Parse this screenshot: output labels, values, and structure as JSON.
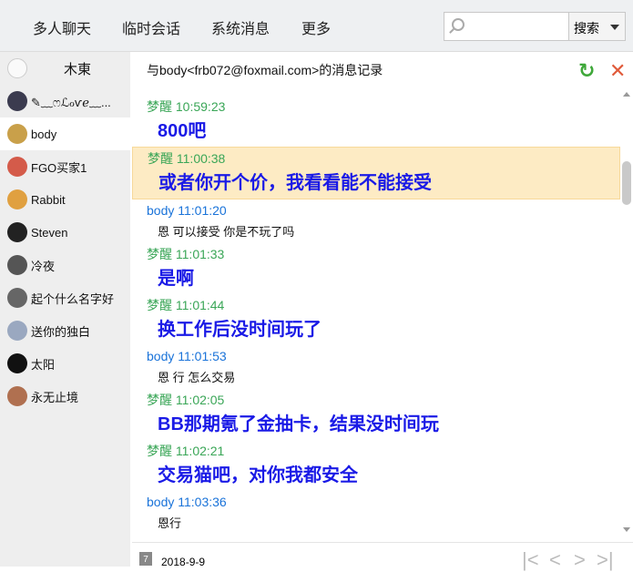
{
  "nav": {
    "items": [
      "多人聊天",
      "临时会话",
      "系统消息",
      "更多"
    ]
  },
  "search": {
    "placeholder": "",
    "button": "搜索"
  },
  "sidebar": {
    "items": [
      {
        "name": "木東",
        "color": "#fafafa"
      },
      {
        "name": "✎﹏ෆℒℴѵℯ﹏...",
        "color": "#3b3b4f"
      },
      {
        "name": "body",
        "color": "#c9a04a"
      },
      {
        "name": "FGO买家1",
        "color": "#d45b4a"
      },
      {
        "name": "Rabbit",
        "color": "#e0a040"
      },
      {
        "name": "Steven",
        "color": "#222222"
      },
      {
        "name": "冷夜",
        "color": "#555555"
      },
      {
        "name": "起个什么名字好",
        "color": "#666666"
      },
      {
        "name": "送你的独白",
        "color": "#9aa8c0"
      },
      {
        "name": "太阳",
        "color": "#111111"
      },
      {
        "name": "永无止境",
        "color": "#b07050"
      }
    ]
  },
  "chat": {
    "title": "与body<frb072@foxmail.com>的消息记录",
    "messages": [
      {
        "sender": "梦醒",
        "time": "10:59:23",
        "text": "800吧",
        "me": true
      },
      {
        "sender": "梦醒",
        "time": "11:00:38",
        "text": "或者你开个价，我看看能不能接受",
        "me": true,
        "highlight": true
      },
      {
        "sender": "body",
        "time": "11:01:20",
        "text": "恩 可以接受  你是不玩了吗",
        "me": false
      },
      {
        "sender": "梦醒",
        "time": "11:01:33",
        "text": "是啊",
        "me": true
      },
      {
        "sender": "梦醒",
        "time": "11:01:44",
        "text": "换工作后没时间玩了",
        "me": true
      },
      {
        "sender": "body",
        "time": "11:01:53",
        "text": "恩 行 怎么交易",
        "me": false
      },
      {
        "sender": "梦醒",
        "time": "11:02:05",
        "text": "BB那期氪了金抽卡，结果没时间玩",
        "me": true
      },
      {
        "sender": "梦醒",
        "time": "11:02:21",
        "text": "交易猫吧，对你我都安全",
        "me": true
      },
      {
        "sender": "body",
        "time": "11:03:36",
        "text": "恩行",
        "me": false
      }
    ]
  },
  "footer": {
    "date": "2018-9-9",
    "calendar_day": "7"
  }
}
